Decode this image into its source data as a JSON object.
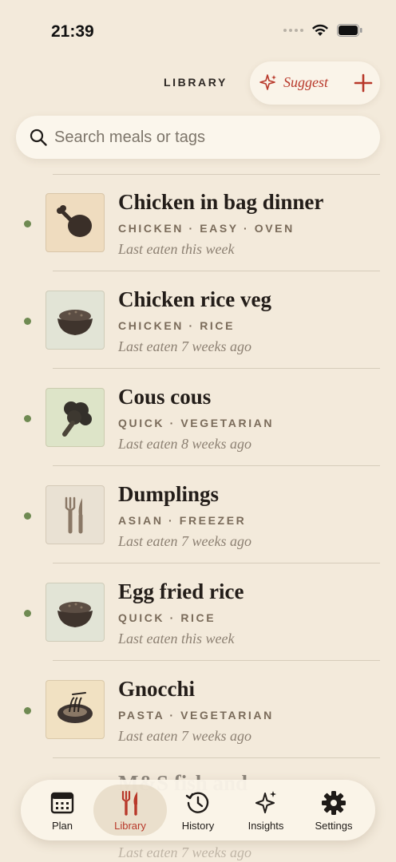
{
  "status": {
    "time": "21:39"
  },
  "header": {
    "title": "LIBRARY",
    "suggest_label": "Suggest"
  },
  "search": {
    "placeholder": "Search meals or tags",
    "value": ""
  },
  "meals": [
    {
      "name": "Chicken in bag dinner",
      "tags": "CHICKEN · EASY · OVEN",
      "last": "Last eaten this week",
      "icon": "drumstick-icon",
      "bg": "#efdcbf"
    },
    {
      "name": "Chicken rice veg",
      "tags": "CHICKEN · RICE",
      "last": "Last eaten 7 weeks ago",
      "icon": "rice-bowl-icon",
      "bg": "#e2e4d6"
    },
    {
      "name": "Cous cous",
      "tags": "QUICK · VEGETARIAN",
      "last": "Last eaten 8 weeks ago",
      "icon": "broccoli-icon",
      "bg": "#dde4c8"
    },
    {
      "name": "Dumplings",
      "tags": "ASIAN · FREEZER",
      "last": "Last eaten 7 weeks ago",
      "icon": "fork-knife-icon",
      "bg": "#e9e1d3"
    },
    {
      "name": "Egg fried rice",
      "tags": "QUICK · RICE",
      "last": "Last eaten this week",
      "icon": "rice-bowl-icon",
      "bg": "#e2e4d6"
    },
    {
      "name": "Gnocchi",
      "tags": "PASTA · VEGETARIAN",
      "last": "Last eaten 7 weeks ago",
      "icon": "noodle-bowl-icon",
      "bg": "#f1e1c2"
    }
  ],
  "partial_row": {
    "name": "M&S fish and",
    "last": "Last eaten 7 weeks ago"
  },
  "tabs": [
    {
      "label": "Plan",
      "icon": "calendar-icon",
      "active": false
    },
    {
      "label": "Library",
      "icon": "fork-knife-icon",
      "active": true
    },
    {
      "label": "History",
      "icon": "clock-history-icon",
      "active": false
    },
    {
      "label": "Insights",
      "icon": "sparkles-icon",
      "active": false
    },
    {
      "label": "Settings",
      "icon": "gear-icon",
      "active": false
    }
  ],
  "colors": {
    "accent": "#b8382a",
    "background": "#f3eadb",
    "dot": "#6f8a52"
  }
}
